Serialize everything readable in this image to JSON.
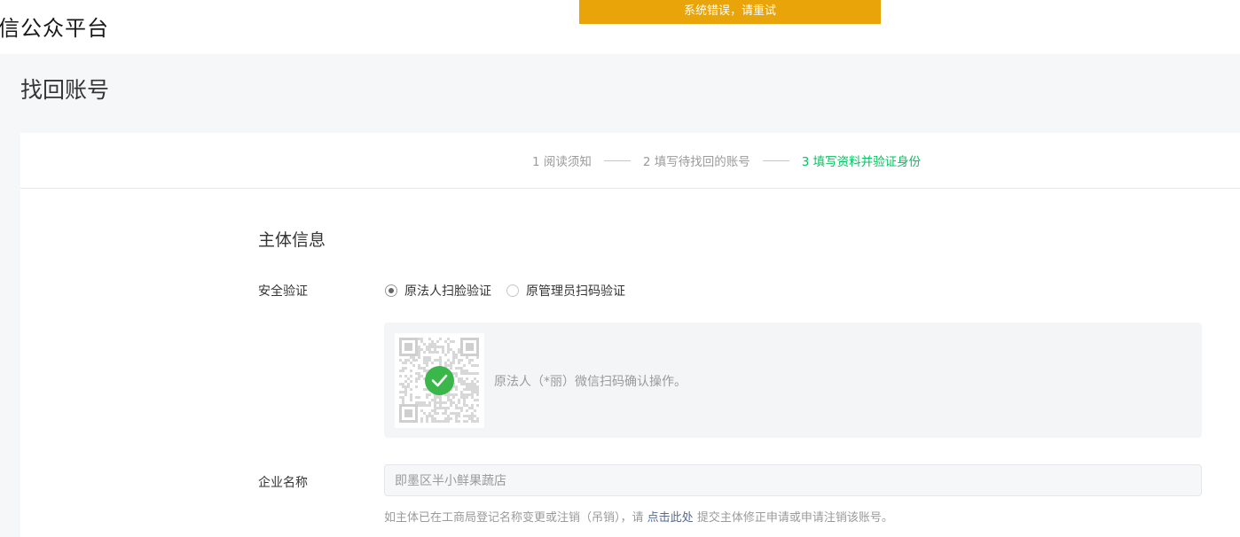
{
  "header": {
    "brand": "信公众平台"
  },
  "toast": {
    "message": "系统错误，请重试",
    "color": "#e8a408"
  },
  "page": {
    "title": "找回账号"
  },
  "steps": [
    {
      "label": "1 阅读须知",
      "active": false
    },
    {
      "label": "2 填写待找回的账号",
      "active": false
    },
    {
      "label": "3 填写资料并验证身份",
      "active": true
    }
  ],
  "form": {
    "section_title": "主体信息",
    "security": {
      "label": "安全验证",
      "options": [
        {
          "label": "原法人扫脸验证",
          "checked": true
        },
        {
          "label": "原管理员扫码验证",
          "checked": false
        }
      ],
      "qr_message": "原法人（*丽）微信扫码确认操作。",
      "qr_status_icon": "check-circle-icon"
    },
    "company": {
      "label": "企业名称",
      "value": "即墨区半小鲜果蔬店"
    },
    "hint": {
      "before": "如主体已在工商局登记名称变更或注销（吊销），请",
      "link": "点击此处",
      "after": "提交主体修正申请或申请注销该账号。"
    }
  },
  "colors": {
    "accent_green": "#07c160",
    "link_blue": "#576b95",
    "check_green": "#3bb64a"
  }
}
